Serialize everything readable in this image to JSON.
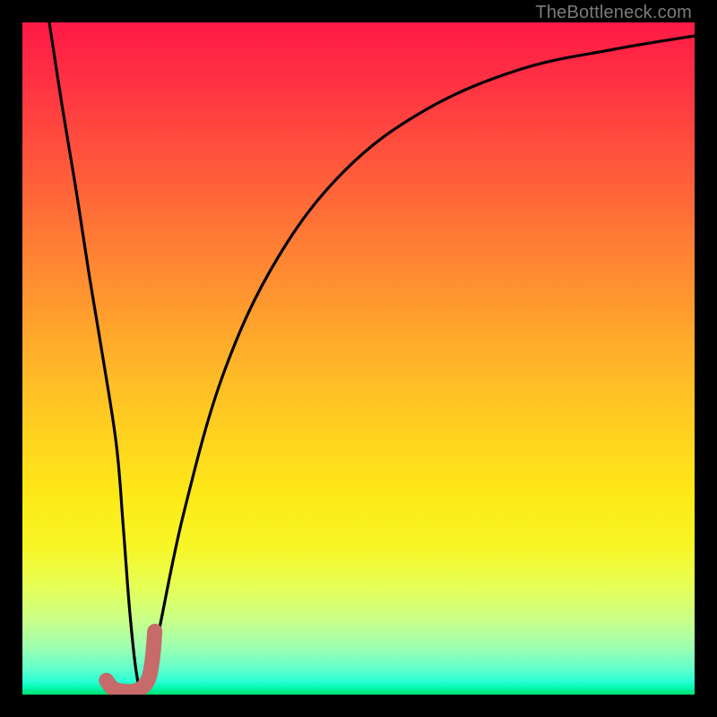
{
  "attribution": "TheBottleneck.com",
  "colors": {
    "frame_bg": "#000000",
    "curve_stroke": "#000000",
    "highlight_stroke": "#c76a6a",
    "gradient_top": "#ff1a46",
    "gradient_bottom": "#00e070"
  },
  "chart_data": {
    "type": "line",
    "title": "",
    "xlabel": "",
    "ylabel": "",
    "xlim": [
      0,
      100
    ],
    "ylim": [
      0,
      100
    ],
    "grid": false,
    "legend": false,
    "series": [
      {
        "name": "bottleneck-curve",
        "x": [
          4,
          6,
          8,
          10,
          12,
          14,
          15,
          16,
          17,
          18,
          20,
          24,
          30,
          38,
          48,
          60,
          74,
          88,
          100
        ],
        "values": [
          100,
          87,
          75,
          62,
          50,
          37,
          25,
          12,
          3,
          0,
          8,
          27,
          48,
          65,
          78,
          87,
          93,
          96,
          98
        ]
      }
    ],
    "annotations": [
      {
        "name": "J-highlight",
        "type": "stroke",
        "color": "#c76a6a",
        "points_x": [
          12.5,
          13.5,
          15.0,
          17.0,
          18.6,
          19.3,
          19.7
        ],
        "points_y": [
          2.1,
          0.9,
          0.5,
          0.6,
          2.0,
          5.0,
          9.4
        ]
      }
    ],
    "background_gradient": {
      "orientation": "vertical",
      "stops": [
        {
          "pos": 0.0,
          "color": "#ff1a46"
        },
        {
          "pos": 0.3,
          "color": "#ff7436"
        },
        {
          "pos": 0.62,
          "color": "#ffd41f"
        },
        {
          "pos": 0.84,
          "color": "#e6ff56"
        },
        {
          "pos": 1.0,
          "color": "#00e070"
        }
      ]
    }
  }
}
